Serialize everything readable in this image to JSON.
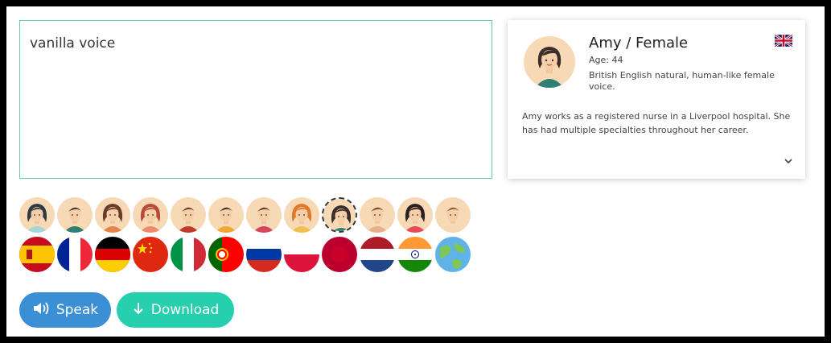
{
  "textbox": {
    "value": "vanilla voice"
  },
  "card": {
    "name": "Amy / Female",
    "age": "Age: 44",
    "description": "British English natural, human-like female voice.",
    "bio": "Amy works as a registered nurse in a Liverpool hospital. She has had multiple specialties throughout her career.",
    "flag_icon": "uk-flag-icon",
    "expand_icon": "chevron-down-icon"
  },
  "voices": [
    {
      "id": "voice-1",
      "hair": "#2f3a44",
      "shirt": "#9fd8d6",
      "long": true
    },
    {
      "id": "voice-2",
      "hair": "#3a2d2a",
      "shirt": "#2f7f72",
      "long": false
    },
    {
      "id": "voice-3",
      "hair": "#6b3b2a",
      "shirt": "#e8824b",
      "long": true
    },
    {
      "id": "voice-4",
      "hair": "#b84a3a",
      "shirt": "#f08a6a",
      "long": true
    },
    {
      "id": "voice-5",
      "hair": "#5a3b2a",
      "shirt": "#c0392b",
      "long": false
    },
    {
      "id": "voice-6",
      "hair": "#3c2a20",
      "shirt": "#f0a830",
      "long": false
    },
    {
      "id": "voice-7",
      "hair": "#5a3020",
      "shirt": "#d6455a",
      "long": false
    },
    {
      "id": "voice-8",
      "hair": "#e07a2a",
      "shirt": "#f2c04e",
      "long": true
    },
    {
      "id": "voice-9",
      "hair": "#3a2d2a",
      "shirt": "#2f7f72",
      "long": true,
      "selected": true
    },
    {
      "id": "voice-10",
      "hair": "#6b4a2a",
      "shirt": "#e8b08a",
      "long": false
    },
    {
      "id": "voice-11",
      "hair": "#2a2020",
      "shirt": "#e84a5a",
      "long": true
    },
    {
      "id": "voice-12",
      "hair": "#8a5a30",
      "shirt": "#f4d9b8",
      "long": false
    }
  ],
  "languages": [
    {
      "id": "spanish-flag-icon"
    },
    {
      "id": "french-flag-icon"
    },
    {
      "id": "german-flag-icon"
    },
    {
      "id": "chinese-flag-icon"
    },
    {
      "id": "italian-flag-icon"
    },
    {
      "id": "portuguese-flag-icon"
    },
    {
      "id": "russian-flag-icon"
    },
    {
      "id": "polish-flag-icon"
    },
    {
      "id": "japanese-flag-icon"
    },
    {
      "id": "dutch-flag-icon"
    },
    {
      "id": "indian-flag-icon"
    },
    {
      "id": "globe-icon"
    }
  ],
  "buttons": {
    "speak": "Speak",
    "download": "Download"
  },
  "colors": {
    "accent_blue": "#3b8fd5",
    "accent_teal": "#26cfae",
    "textbox_border": "#5fcab7",
    "skin": "#f8d9b6"
  }
}
